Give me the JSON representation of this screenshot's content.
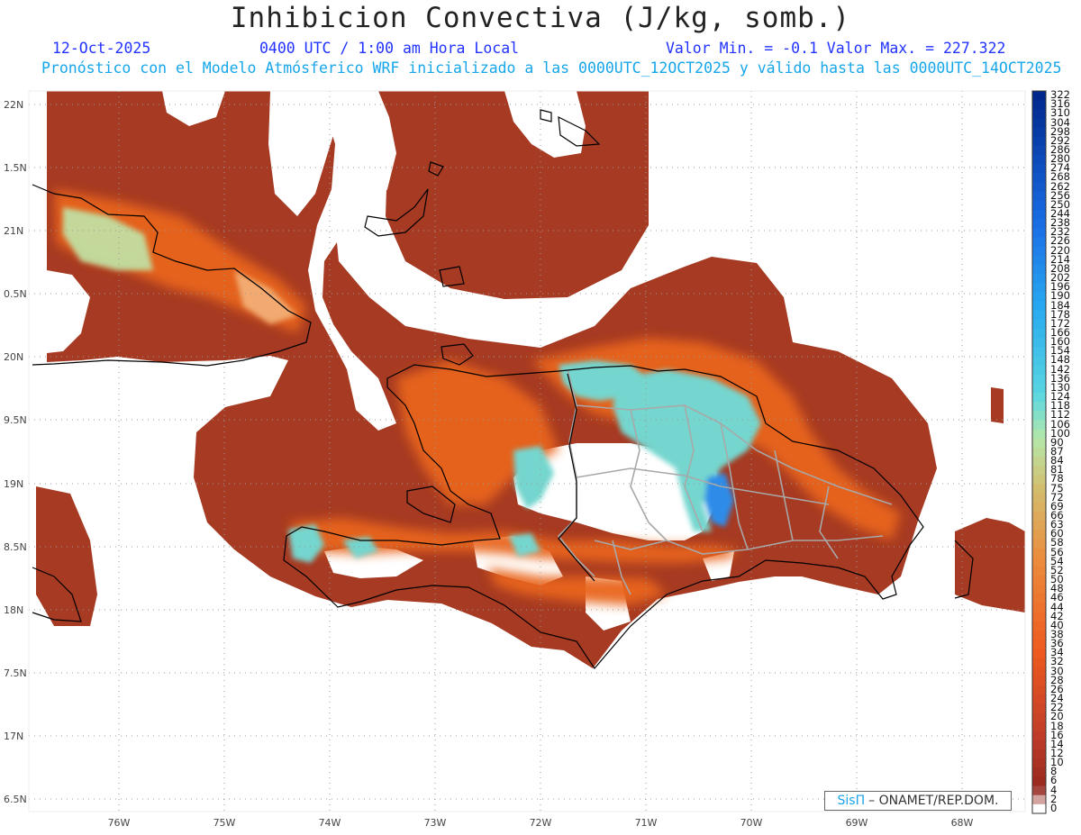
{
  "header": {
    "title": "Inhibicion Convectiva (J/kg, somb.)",
    "date": "12-Oct-2025",
    "time": "0400 UTC / 1:00 am Hora Local",
    "minmax": "Valor Min. = -0.1  Valor Max. = 227.322",
    "forecast": "Pronóstico con el Modelo Atmósferico WRF inicializado a las 0000UTC_12OCT2025 y válido hasta las  0000UTC_14OCT2025"
  },
  "map": {
    "lat_labels": [
      "22N",
      "1.5N",
      "21N",
      "0.5N",
      "20N",
      "9.5N",
      "19N",
      "8.5N",
      "18N",
      "7.5N",
      "17N",
      "6.5N"
    ],
    "lon_labels": [
      "76W",
      "75W",
      "74W",
      "73W",
      "72W",
      "71W",
      "70W",
      "69W",
      "68W"
    ],
    "colors": {
      "low": "#a63a22",
      "mid": "#e9651f",
      "high": "#75d6cf",
      "peak": "#2d8ce8",
      "border": "#a8a8a8",
      "coast": "#000000"
    }
  },
  "colorbar": {
    "labels": [
      "322",
      "316",
      "310",
      "304",
      "298",
      "292",
      "286",
      "280",
      "274",
      "268",
      "262",
      "256",
      "250",
      "244",
      "238",
      "232",
      "226",
      "220",
      "214",
      "208",
      "202",
      "196",
      "190",
      "184",
      "178",
      "172",
      "166",
      "160",
      "154",
      "148",
      "142",
      "136",
      "130",
      "124",
      "118",
      "112",
      "106",
      "100",
      "90",
      "87",
      "84",
      "81",
      "78",
      "75",
      "72",
      "69",
      "66",
      "63",
      "60",
      "58",
      "56",
      "54",
      "52",
      "50",
      "48",
      "46",
      "44",
      "42",
      "40",
      "38",
      "36",
      "34",
      "32",
      "30",
      "28",
      "26",
      "24",
      "22",
      "20",
      "18",
      "16",
      "14",
      "12",
      "10",
      "8",
      "6",
      "4",
      "2",
      "0"
    ]
  },
  "credit": {
    "brand": "SisΠ",
    "text": "– ONAMET/REP.DOM."
  }
}
